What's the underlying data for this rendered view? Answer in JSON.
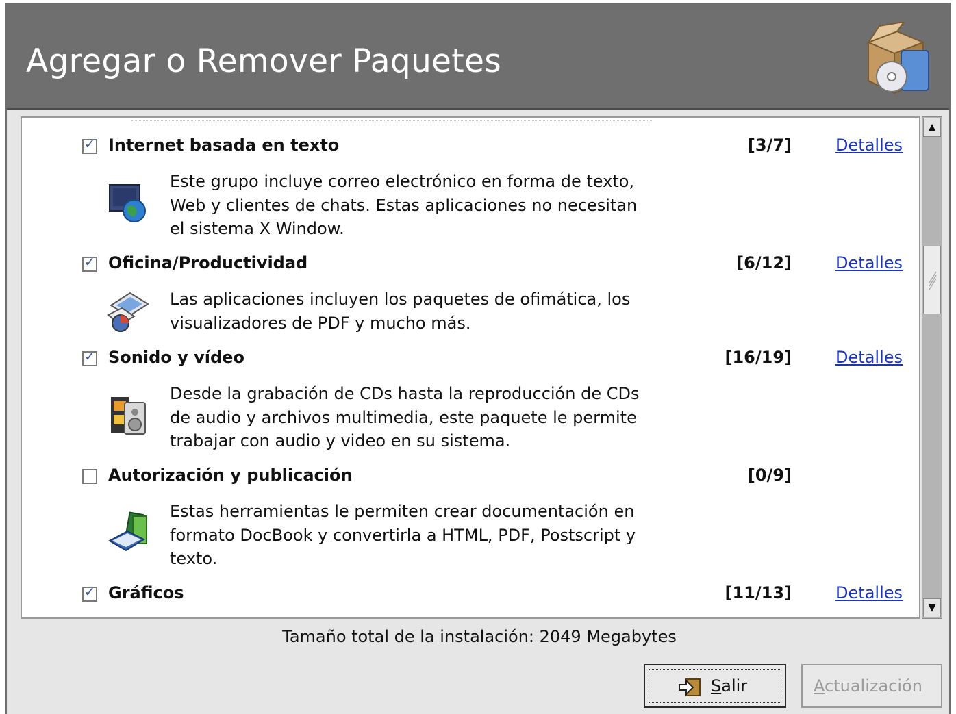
{
  "window": {
    "title": "Agregar o Remover Paquetes"
  },
  "groups": [
    {
      "name": "Internet basada en texto",
      "checked": true,
      "count": "[3/7]",
      "details_label": "Detalles",
      "icon": "internet-globe-icon",
      "description": [
        "Este grupo incluye correo electrónico en forma de texto,",
        "Web y clientes de chats. Estas aplicaciones no necesitan",
        "el sistema X Window."
      ]
    },
    {
      "name": "Oficina/Productividad",
      "checked": true,
      "count": "[6/12]",
      "details_label": "Detalles",
      "icon": "office-documents-icon",
      "description": [
        "Las aplicaciones incluyen los paquetes de ofimática, los",
        "visualizadores de PDF y mucho más."
      ]
    },
    {
      "name": "Sonido y vídeo",
      "checked": true,
      "count": "[16/19]",
      "details_label": "Detalles",
      "icon": "film-speaker-icon",
      "description": [
        "Desde la grabación de CDs hasta la reproducción de CDs",
        "de audio y archivos multimedia, este paquete le permite",
        "trabajar con audio y video en su sistema."
      ]
    },
    {
      "name": "Autorización y publicación",
      "checked": false,
      "count": "[0/9]",
      "details_label": "",
      "icon": "books-icon",
      "description": [
        "Estas herramientas le permiten crear documentación en",
        "formato DocBook y convertirla a HTML, PDF, Postscript y",
        "texto."
      ]
    },
    {
      "name": "Gráficos",
      "checked": true,
      "count": "[11/13]",
      "details_label": "Detalles",
      "icon": "",
      "description": []
    }
  ],
  "footer": {
    "total_size": "Tamaño total de la instalación: 2049 Megabytes",
    "quit_label_first": "S",
    "quit_label_rest": "alir",
    "update_label_first": "A",
    "update_label_rest": "ctualización"
  },
  "colors": {
    "header_bg": "#6f6f6f",
    "link": "#1a35b8",
    "check": "#3a59a8"
  }
}
